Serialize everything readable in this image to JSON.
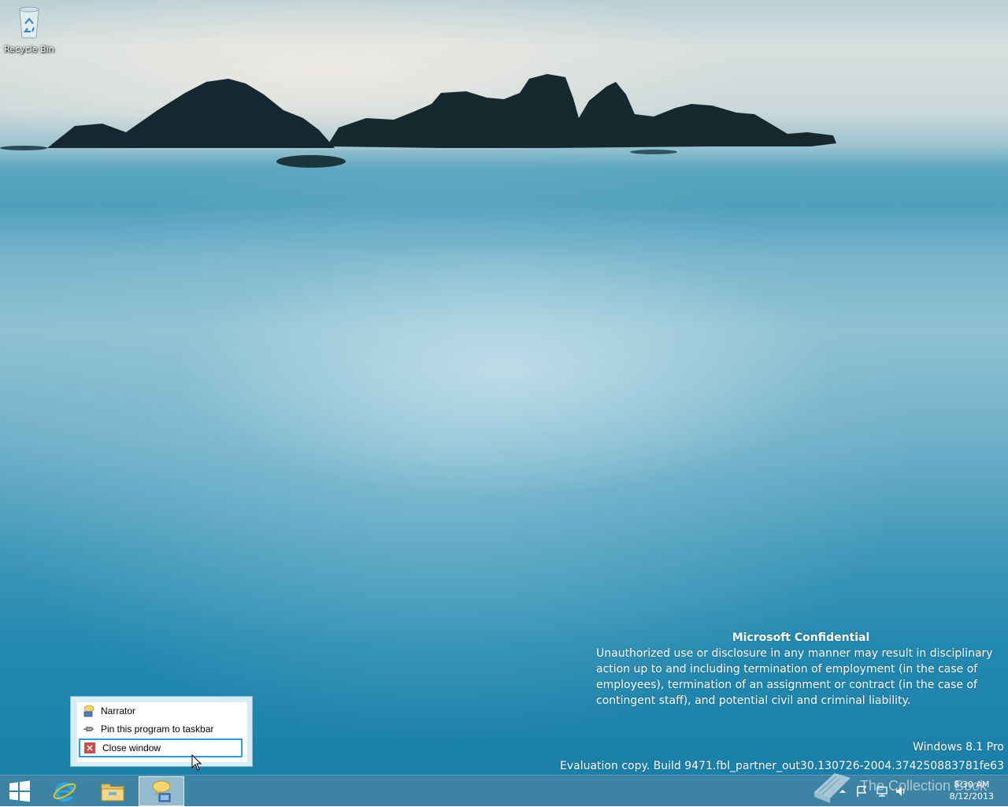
{
  "desktop": {
    "icons": [
      {
        "label": "Recycle Bin",
        "icon": "recycle-bin-icon"
      }
    ]
  },
  "watermark": {
    "heading": "Microsoft Confidential",
    "body": "Unauthorized use or disclosure in any manner may result in disciplinary action up to and including termination of employment (in the case of employees), termination of an assignment or contract (in the case of contingent staff), and potential civil and criminal liability.",
    "edition": "Windows 8.1 Pro",
    "build": "Evaluation copy. Build 9471.fbl_partner_out30.130726-2004.374250883781fe63"
  },
  "jump_list": {
    "items": [
      {
        "label": "Narrator",
        "icon": "narrator-icon"
      },
      {
        "label": "Pin this program to taskbar",
        "icon": "pin-icon"
      },
      {
        "label": "Close window",
        "icon": "close-icon",
        "selected": true
      }
    ]
  },
  "taskbar": {
    "buttons": [
      {
        "name": "start",
        "icon": "windows-logo-icon"
      },
      {
        "name": "internet-explorer",
        "icon": "internet-explorer-icon"
      },
      {
        "name": "file-explorer",
        "icon": "folder-icon"
      },
      {
        "name": "narrator",
        "icon": "narrator-icon",
        "active": true
      }
    ],
    "tray": {
      "icons": [
        "show-hidden-icons-arrow",
        "action-center-flag-icon",
        "network-icon",
        "volume-icon"
      ],
      "time": "8:30 AM",
      "date": "8/12/2013"
    }
  },
  "brand_watermark": {
    "text": "The Collection Book",
    "icon": "book-icon"
  },
  "colors": {
    "taskbar": "#3d83a4",
    "selection_border": "#26a0da",
    "jump_list_frame": "#d9ecf3"
  }
}
